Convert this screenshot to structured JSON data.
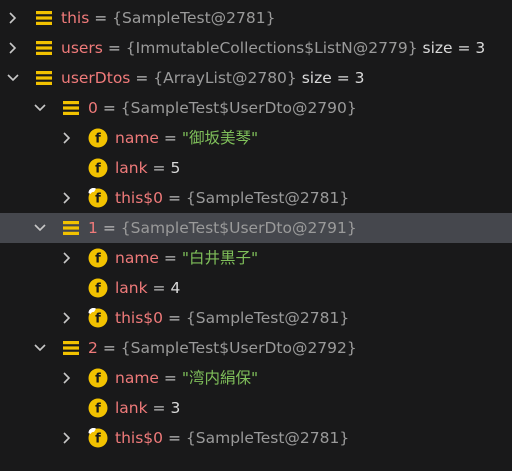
{
  "colors": {
    "background": "#19191a",
    "selected_row": "#45474d",
    "name": "#ef7a7a",
    "string_value": "#7fbf5a",
    "object_ref": "#9a9a9a",
    "list_icon": "#f2c200",
    "field_icon": "#f2c200"
  },
  "rows": [
    {
      "name": "this",
      "eq": "=",
      "value": "{SampleTest@2781}",
      "extra": "",
      "icon": "list-icon",
      "chevron": "right"
    },
    {
      "name": "users",
      "eq": "=",
      "value": "{ImmutableCollections$ListN@2779}",
      "extra": "size = 3",
      "icon": "list-icon",
      "chevron": "right"
    },
    {
      "name": "userDtos",
      "eq": "=",
      "value": "{ArrayList@2780}",
      "extra": "size = 3",
      "icon": "list-icon",
      "chevron": "down"
    },
    {
      "name": "0",
      "eq": "=",
      "value": "{SampleTest$UserDto@2790}",
      "extra": "",
      "icon": "list-icon",
      "chevron": "down"
    },
    {
      "name": "name",
      "eq": "=",
      "value": "\"御坂美琴\"",
      "extra": "",
      "icon": "field-icon",
      "chevron": "right"
    },
    {
      "name": "lank",
      "eq": "=",
      "value": "5",
      "extra": "",
      "icon": "field-icon",
      "chevron": "none"
    },
    {
      "name": "this$0",
      "eq": "=",
      "value": "{SampleTest@2781}",
      "extra": "",
      "icon": "field-outer-icon",
      "chevron": "right"
    },
    {
      "name": "1",
      "eq": "=",
      "value": "{SampleTest$UserDto@2791}",
      "extra": "",
      "icon": "list-icon",
      "chevron": "down"
    },
    {
      "name": "name",
      "eq": "=",
      "value": "\"白井黒子\"",
      "extra": "",
      "icon": "field-icon",
      "chevron": "right"
    },
    {
      "name": "lank",
      "eq": "=",
      "value": "4",
      "extra": "",
      "icon": "field-icon",
      "chevron": "none"
    },
    {
      "name": "this$0",
      "eq": "=",
      "value": "{SampleTest@2781}",
      "extra": "",
      "icon": "field-outer-icon",
      "chevron": "right"
    },
    {
      "name": "2",
      "eq": "=",
      "value": "{SampleTest$UserDto@2792}",
      "extra": "",
      "icon": "list-icon",
      "chevron": "down"
    },
    {
      "name": "name",
      "eq": "=",
      "value": "\"湾内絹保\"",
      "extra": "",
      "icon": "field-icon",
      "chevron": "right"
    },
    {
      "name": "lank",
      "eq": "=",
      "value": "3",
      "extra": "",
      "icon": "field-icon",
      "chevron": "none"
    },
    {
      "name": "this$0",
      "eq": "=",
      "value": "{SampleTest@2781}",
      "extra": "",
      "icon": "field-outer-icon",
      "chevron": "right"
    }
  ],
  "icons": {
    "field_letter": "f"
  }
}
